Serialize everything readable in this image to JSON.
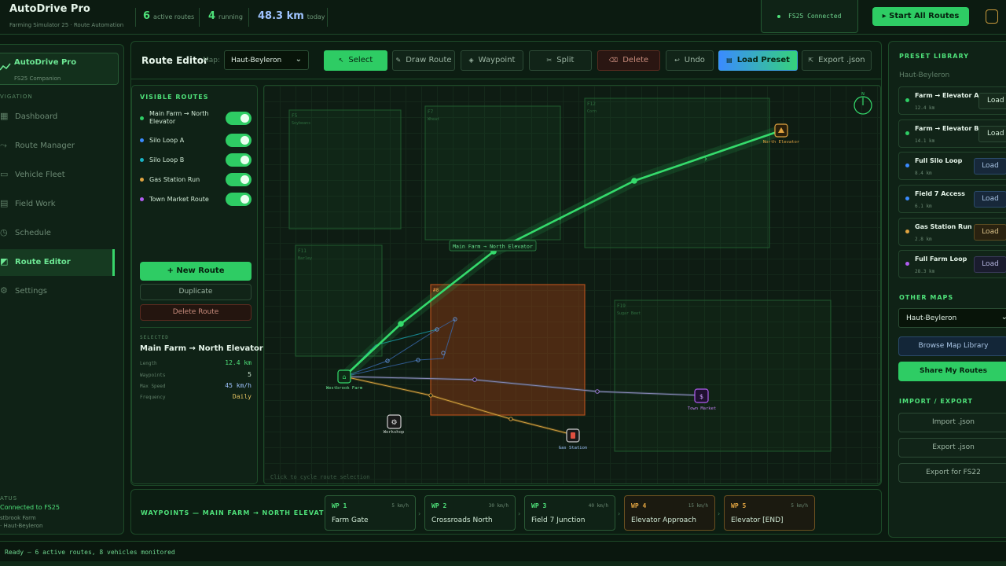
{
  "topbar": {
    "app_title": "AutoDrive Pro",
    "app_subtitle": "Farming Simulator 25 · Route Automation",
    "stats": [
      {
        "value": "6",
        "label": "active routes"
      },
      {
        "value": "4",
        "label": "running"
      },
      {
        "value": "48.3 km",
        "label": "today"
      }
    ],
    "connection": "FS25   Connected",
    "start_all": "▸ Start All Routes"
  },
  "nav": {
    "brand_name": "AutoDrive Pro",
    "brand_sub": "FS25 Companion",
    "heading": "VIGATION",
    "items": [
      {
        "label": "Dashboard",
        "icon": "grid-icon"
      },
      {
        "label": "Route Manager",
        "icon": "route-icon"
      },
      {
        "label": "Vehicle Fleet",
        "icon": "tractor-icon"
      },
      {
        "label": "Field Work",
        "icon": "field-icon"
      },
      {
        "label": "Schedule",
        "icon": "clock-icon"
      },
      {
        "label": "Route Editor",
        "icon": "editor-icon"
      },
      {
        "label": "Settings",
        "icon": "gear-icon"
      }
    ],
    "status_heading": "ATUS",
    "status_line1": "Connected to FS25",
    "status_line2": "stbrook Farm",
    "status_line3": "· Haut-Beyleron"
  },
  "toolbar": {
    "title": "Route Editor",
    "map_label": "Map:",
    "map_value": "Haut-Beyleron",
    "buttons": [
      "Select",
      "Draw Route",
      "Waypoint",
      "Split",
      "Delete",
      "Undo",
      "Load Preset",
      "Export .json"
    ]
  },
  "routes_panel": {
    "heading": "VISIBLE ROUTES",
    "routes": [
      {
        "label": "Main Farm → North Elevator",
        "color": "#2ecc64"
      },
      {
        "label": "Silo Loop A",
        "color": "#3a8bff"
      },
      {
        "label": "Silo Loop B",
        "color": "#19b3c4"
      },
      {
        "label": "Gas Station Run",
        "color": "#e0a340"
      },
      {
        "label": "Town Market Route",
        "color": "#b05cf0"
      }
    ],
    "new_route": "+ New Route",
    "duplicate": "Duplicate",
    "delete_route": "Delete Route",
    "selected_heading": "SELECTED",
    "selected_name": "Main Farm → North Elevator",
    "props": [
      {
        "key": "Length",
        "value": "12.4 km",
        "color": "#4ee079"
      },
      {
        "key": "Waypoints",
        "value": "5",
        "color": "#cfe8d4"
      },
      {
        "key": "Max Speed",
        "value": "45 km/h",
        "color": "#9fc4ff"
      },
      {
        "key": "Frequency",
        "value": "Daily",
        "color": "#e0c060"
      }
    ]
  },
  "map": {
    "fields": [
      {
        "id": "F5",
        "crop": "Soybeans"
      },
      {
        "id": "F7",
        "crop": "Wheat"
      },
      {
        "id": "F12",
        "crop": "Corn"
      },
      {
        "id": "F11",
        "crop": "Barley"
      },
      {
        "id": "#8",
        "crop": ""
      },
      {
        "id": "F19",
        "crop": "Sugar Beet"
      }
    ],
    "route_label": "Main Farm → North Elevator",
    "poi": {
      "farm": "Westbrook Farm",
      "elevator": "North Elevator",
      "workshop": "Workshop",
      "gas": "Gas Station",
      "market": "Town Market"
    },
    "hint": "Click to cycle route selection"
  },
  "waypoints": {
    "heading": "WAYPOINTS — MAIN FARM → NORTH ELEVATOR",
    "items": [
      {
        "id": "WP 1",
        "speed": "5 km/h",
        "name": "Farm Gate"
      },
      {
        "id": "WP 2",
        "speed": "30 km/h",
        "name": "Crossroads North"
      },
      {
        "id": "WP 3",
        "speed": "40 km/h",
        "name": "Field 7 Junction"
      },
      {
        "id": "WP 4",
        "speed": "15 km/h",
        "name": "Elevator Approach"
      },
      {
        "id": "WP 5",
        "speed": "5 km/h",
        "name": "Elevator [END]"
      }
    ]
  },
  "right_panel": {
    "preset_heading": "PRESET LIBRARY",
    "map_name": "Haut-Beyleron",
    "presets": [
      {
        "name": "Farm → Elevator A",
        "km": "12.4 km",
        "load": "Load",
        "color": "#2ecc64"
      },
      {
        "name": "Farm → Elevator B",
        "km": "14.1 km",
        "load": "Load",
        "color": "#2ecc64"
      },
      {
        "name": "Full Silo Loop",
        "km": "8.4 km",
        "load": "Load",
        "color": "#3a8bff"
      },
      {
        "name": "Field 7 Access",
        "km": "6.1 km",
        "load": "Load",
        "color": "#3a8bff"
      },
      {
        "name": "Gas Station Run",
        "km": "2.8 km",
        "load": "Load",
        "color": "#e0a340"
      },
      {
        "name": "Full Farm Loop",
        "km": "28.3 km",
        "load": "Load",
        "color": "#b05cf0"
      }
    ],
    "other_maps_heading": "OTHER MAPS",
    "other_map_value": "Haut-Beyleron",
    "browse": "Browse Map Library",
    "share": "Share My Routes",
    "import_export_heading": "IMPORT / EXPORT",
    "import": "Import .json",
    "export": "Export .json",
    "export_fs22": "Export for FS22"
  },
  "footer": {
    "text": "Ready — 6 active routes, 8 vehicles monitored"
  }
}
